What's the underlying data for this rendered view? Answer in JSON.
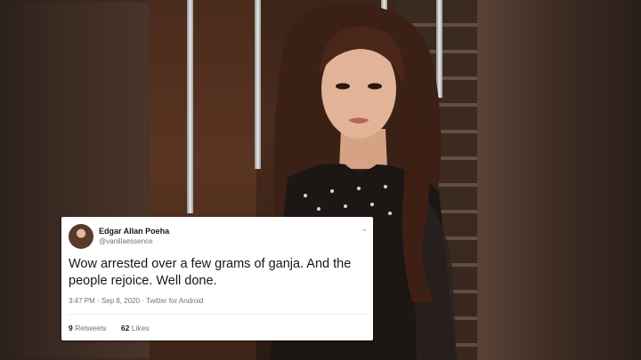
{
  "tweet": {
    "author_name": "Edgar Allan Poeha",
    "handle": "@vanillaessence",
    "text": "Wow arrested over a few grams of ganja. And the people rejoice. Well done.",
    "timestamp": "3:47 PM · Sep 8, 2020 · Twitter for Android",
    "retweets_count": "9",
    "retweets_label": "Retweets",
    "likes_count": "62",
    "likes_label": "Likes"
  },
  "icons": {
    "menu": "chevron-down-icon",
    "avatar": "avatar-icon"
  },
  "colors": {
    "text_primary": "#14171a",
    "text_secondary": "#657786",
    "card_bg": "#ffffff"
  }
}
